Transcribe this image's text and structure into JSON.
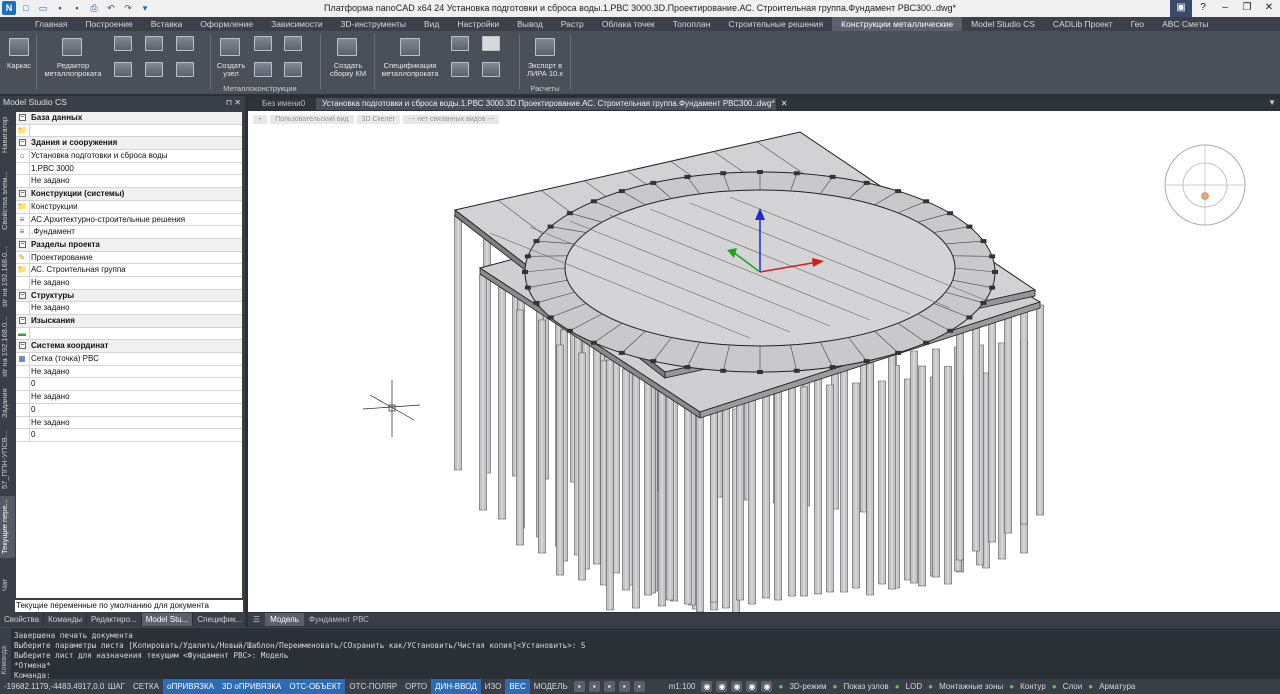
{
  "window": {
    "title": "Платформа nanoCAD x64 24 Установка подготовки и сброса воды.1.РВС 3000.3D.Проектирование.АС. Строительная группа.Фундамент РВС300..dwg*"
  },
  "menu": {
    "tabs": [
      "Главная",
      "Построение",
      "Вставка",
      "Оформление",
      "Зависимости",
      "3D-инструменты",
      "Вид",
      "Настройки",
      "Вывод",
      "Растр",
      "Облака точек",
      "Топоплан",
      "Строительные решения",
      "Конструкции металлические",
      "Model Studio CS",
      "CADLib Проект",
      "Гео",
      "ABC Сметы"
    ],
    "active_index": 13
  },
  "ribbon": {
    "karkas": "Каркас",
    "editor_l1": "Редактор",
    "editor_l2": "металлопроката",
    "create_node_l1": "Создать",
    "create_node_l2": "узел",
    "create_km_l1": "Создать",
    "create_km_l2": "сборку КМ",
    "spec_l1": "Спецификация",
    "spec_l2": "металлопроката",
    "export_l1": "Экспорт в",
    "export_l2": "ЛИРА 10.х",
    "group_metal": "Металлоконструкции",
    "group_calc": "Расчеты"
  },
  "panel": {
    "title": "Model Studio CS",
    "vtabs": [
      "Навигатор",
      "Свойства элем...",
      "str на 192.168.0...",
      "str на 192.168.0...",
      "Задания",
      "57_ППН-УПСВ...",
      "Текущие пере...",
      "Чат"
    ],
    "rows": [
      {
        "type": "cat",
        "text": "База данных"
      },
      {
        "type": "row",
        "icon": "folder",
        "text": ""
      },
      {
        "type": "cat",
        "text": "Здания и сооружения"
      },
      {
        "type": "row",
        "icon": "building",
        "text": "Установка подготовки и сброса воды"
      },
      {
        "type": "row",
        "icon": "",
        "text": "1.РВС 3000"
      },
      {
        "type": "row",
        "icon": "",
        "text": "Не задано"
      },
      {
        "type": "cat",
        "text": "Конструкции (системы)"
      },
      {
        "type": "row",
        "icon": "folder",
        "text": "Конструкции"
      },
      {
        "type": "row",
        "icon": "stack",
        "text": "АС.Архитектурно-строительные решения"
      },
      {
        "type": "row",
        "icon": "stack",
        "text": ".Фундамент"
      },
      {
        "type": "cat",
        "text": "Разделы проекта"
      },
      {
        "type": "row",
        "icon": "pencil",
        "text": "Проектирование"
      },
      {
        "type": "row",
        "icon": "folder",
        "text": "АС. Строительная группа"
      },
      {
        "type": "row",
        "icon": "",
        "text": "Не задано"
      },
      {
        "type": "cat",
        "text": "Структуры"
      },
      {
        "type": "row",
        "icon": "",
        "text": "Не задано"
      },
      {
        "type": "cat",
        "text": "Изыскания"
      },
      {
        "type": "row",
        "icon": "survey",
        "text": ""
      },
      {
        "type": "cat",
        "text": "Система координат"
      },
      {
        "type": "row",
        "icon": "grid",
        "text": "Сетка (точка) РВС"
      },
      {
        "type": "row",
        "icon": "",
        "text": "Не задано"
      },
      {
        "type": "row",
        "icon": "",
        "text": "0"
      },
      {
        "type": "row",
        "icon": "",
        "text": "Не задано"
      },
      {
        "type": "row",
        "icon": "",
        "text": "0"
      },
      {
        "type": "row",
        "icon": "",
        "text": "Не задано"
      },
      {
        "type": "row",
        "icon": "",
        "text": "0"
      }
    ],
    "status": "Текущие переменные по умолчанию для документа",
    "bottom_tabs": [
      "Свойства",
      "Команды",
      "Редактиро...",
      "Model Stu...",
      "Специфик..."
    ],
    "bottom_active": 3
  },
  "doc_tabs": {
    "tab1": "Без имени0",
    "tab2": "Установка подготовки и сброса воды.1.РВС 3000.3D.Проектирование.АС. Строительная группа.Фундамент РВС300..dwg*"
  },
  "viewport": {
    "toolbar": [
      "+",
      "Пользовательский вид",
      "3D Скелет",
      "--- нет связанных видов ---"
    ]
  },
  "layout_tabs": {
    "model": "Модель",
    "sheet": "Фундамент РВС"
  },
  "command": {
    "lines": [
      "Завершена печать документа",
      "Выберите параметры листа [Копировать/Удалить/Новый/Шаблон/Переименовать/СОхранить как/УСтановить/Чистая копия]<Установить>: S",
      "Выберите лист для назначения текущим <Фундамент РВС>: Модель",
      "*Отмена*",
      "Команда:"
    ],
    "side_label": "Команда"
  },
  "status": {
    "coords": "-19682.1179,-4483.4917,0.0000",
    "toggles": [
      {
        "label": "ШАГ",
        "on": false
      },
      {
        "label": "СЕТКА",
        "on": false
      },
      {
        "label": "оПРИВЯЗКА",
        "on": true
      },
      {
        "label": "3D оПРИВЯЗКА",
        "on": true
      },
      {
        "label": "ОТС-ОБЪЕКТ",
        "on": true
      },
      {
        "label": "ОТС-ПОЛЯР",
        "on": false
      },
      {
        "label": "ОРТО",
        "on": false
      },
      {
        "label": "ДИН-ВВОД",
        "on": true
      },
      {
        "label": "ИЗО",
        "on": false
      },
      {
        "label": "ВЕС",
        "on": true
      },
      {
        "label": "МОДЕЛЬ",
        "on": false
      }
    ],
    "scale": "m1:100",
    "right": [
      "3D-режим",
      "Показ узлов",
      "LOD",
      "Монтажные зоны",
      "Контур",
      "Слои",
      "Арматура"
    ]
  },
  "colors": {
    "accent": "#2e6bb5",
    "panel": "#3a3f47",
    "viewport": "#ffffff"
  }
}
